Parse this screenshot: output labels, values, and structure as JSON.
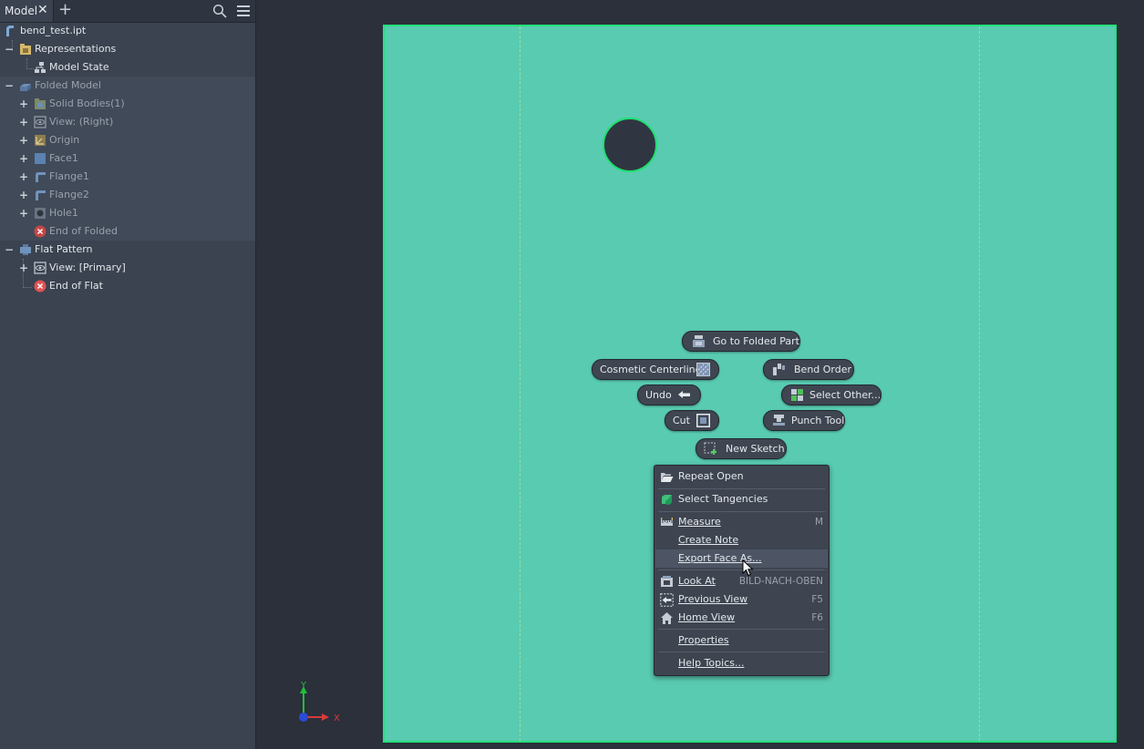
{
  "browser": {
    "tab_label": "Model",
    "tree": {
      "file": "bend_test.ipt",
      "representations": "Representations",
      "model_state": "Model State",
      "folded_model": "Folded Model",
      "solid_bodies": "Solid Bodies(1)",
      "view_right": "View: (Right)",
      "origin": "Origin",
      "face1": "Face1",
      "flange1": "Flange1",
      "flange2": "Flange2",
      "hole1": "Hole1",
      "end_of_folded": "End of Folded",
      "flat_pattern": "Flat Pattern",
      "view_primary": "View: [Primary]",
      "end_of_flat": "End of Flat"
    }
  },
  "marking_menu": {
    "go_to_folded_part": "Go to Folded Part",
    "cosmetic_centerline": "Cosmetic Centerline",
    "bend_order": "Bend Order",
    "undo": "Undo",
    "select_other": "Select Other...",
    "cut": "Cut",
    "punch_tool": "Punch Tool",
    "new_sketch": "New Sketch"
  },
  "context_menu": {
    "repeat_open": "Repeat Open",
    "select_tangencies": "Select Tangencies",
    "measure": "Measure",
    "measure_shortcut": "M",
    "create_note": "Create Note",
    "export_face_as": "Export Face As...",
    "look_at": "Look At",
    "look_at_shortcut": "BILD-NACH-OBEN",
    "previous_view": "Previous View",
    "previous_view_shortcut": "F5",
    "home_view": "Home View",
    "home_view_shortcut": "F6",
    "properties": "Properties",
    "help_topics": "Help Topics..."
  },
  "triad": {
    "y_label": "Y",
    "x_label": "X"
  },
  "colors": {
    "sheet_fill": "#59cbb1",
    "sheet_edge": "#22e27a",
    "viewport_bg": "#2b303b",
    "panel_bg": "#3b4350"
  }
}
